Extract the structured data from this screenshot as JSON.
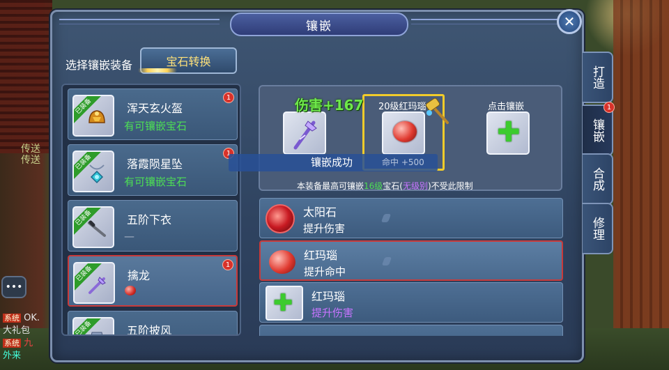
{
  "window": {
    "title": "镶嵌",
    "close_symbol": "✕"
  },
  "scene": {
    "side_text": "传送\n传送",
    "chat": [
      {
        "tag": "系统",
        "text": "OK."
      },
      {
        "tag": "",
        "text": "大礼包"
      },
      {
        "tag": "系统",
        "text": "九"
      },
      {
        "tag": "",
        "text": "外来"
      }
    ]
  },
  "header": {
    "select_label": "选择镶嵌装备",
    "convert_button": "宝石转换"
  },
  "equipment": [
    {
      "name": "浑天玄火盔",
      "status": "有可镶嵌宝石",
      "equipped_label": "已装备",
      "badge": "1"
    },
    {
      "name": "落霞陨星坠",
      "status": "有可镶嵌宝石",
      "equipped_label": "已装备",
      "badge": "1"
    },
    {
      "name": "五阶下衣",
      "status": "—",
      "equipped_label": "已装备",
      "badge": ""
    },
    {
      "name": "擒龙",
      "status": "",
      "equipped_label": "已装备",
      "badge": "1"
    },
    {
      "name": "五阶披风",
      "status": "",
      "equipped_label": "已装备",
      "badge": ""
    }
  ],
  "tabs": [
    {
      "label": "打造",
      "badge": ""
    },
    {
      "label": "镶嵌",
      "badge": "1"
    },
    {
      "label": "合成",
      "badge": ""
    },
    {
      "label": "修理",
      "badge": ""
    }
  ],
  "inlay": {
    "damage_float": "伤害+167",
    "gem_slot_title": "20级红玛瑙",
    "click_title": "点击镶嵌",
    "success_text": "镶嵌成功",
    "hit_text": "命中 +500",
    "note_prefix": "本装备最高可镶嵌",
    "note_level": "16级",
    "note_mid": "宝石(",
    "note_nolevel": "无级别",
    "note_suffix": ")不受此限制"
  },
  "gems": [
    {
      "name": "太阳石",
      "effect": "提升伤害",
      "icon": "sun-gem-icon"
    },
    {
      "name": "红玛瑙",
      "effect": "提升命中",
      "icon": "red-agate-icon"
    },
    {
      "name": "红玛瑙",
      "effect": "提升伤害",
      "icon": "add-gem-icon"
    }
  ],
  "colors": {
    "accent_green": "#4dde55",
    "purple": "#c874ff",
    "badge_red": "#d8322a",
    "gold_frame": "#f2cc2a"
  }
}
